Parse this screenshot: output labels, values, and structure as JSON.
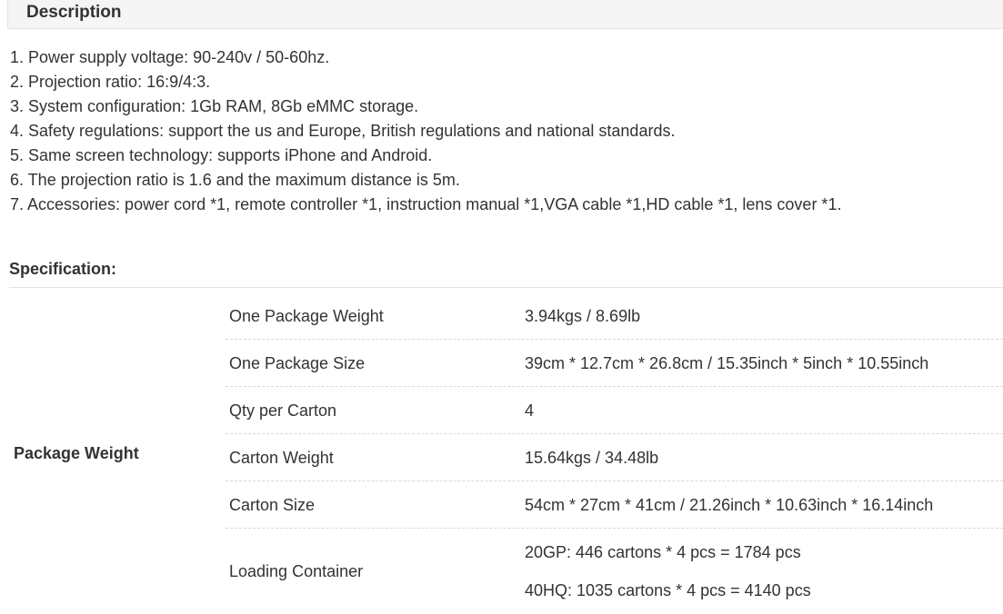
{
  "description": {
    "title": "Description",
    "items": [
      "1. Power supply voltage: 90-240v / 50-60hz.",
      "2. Projection ratio: 16:9/4:3.",
      "3. System configuration: 1Gb RAM, 8Gb eMMC storage.",
      "4. Safety regulations: support the us and Europe, British regulations and national standards.",
      "5. Same screen technology: supports iPhone and Android.",
      "6. The projection ratio is 1.6 and the maximum distance is 5m.",
      "7. Accessories: power cord *1, remote controller *1, instruction manual *1,VGA cable *1,HD cable *1, lens cover *1."
    ]
  },
  "specification": {
    "title": "Specification:",
    "group_label": "Package Weight",
    "rows": [
      {
        "key": "One Package Weight",
        "value": "3.94kgs / 8.69lb"
      },
      {
        "key": "One Package Size",
        "value": "39cm * 12.7cm * 26.8cm / 15.35inch * 5inch * 10.55inch"
      },
      {
        "key": "Qty per Carton",
        "value": "4"
      },
      {
        "key": "Carton Weight",
        "value": "15.64kgs / 34.48lb"
      },
      {
        "key": "Carton Size",
        "value": "54cm * 27cm * 41cm / 21.26inch * 10.63inch * 16.14inch"
      },
      {
        "key": "Loading Container",
        "value": "20GP: 446 cartons * 4 pcs = 1784 pcs",
        "value2": "40HQ: 1035 cartons * 4 pcs = 4140 pcs"
      }
    ]
  }
}
